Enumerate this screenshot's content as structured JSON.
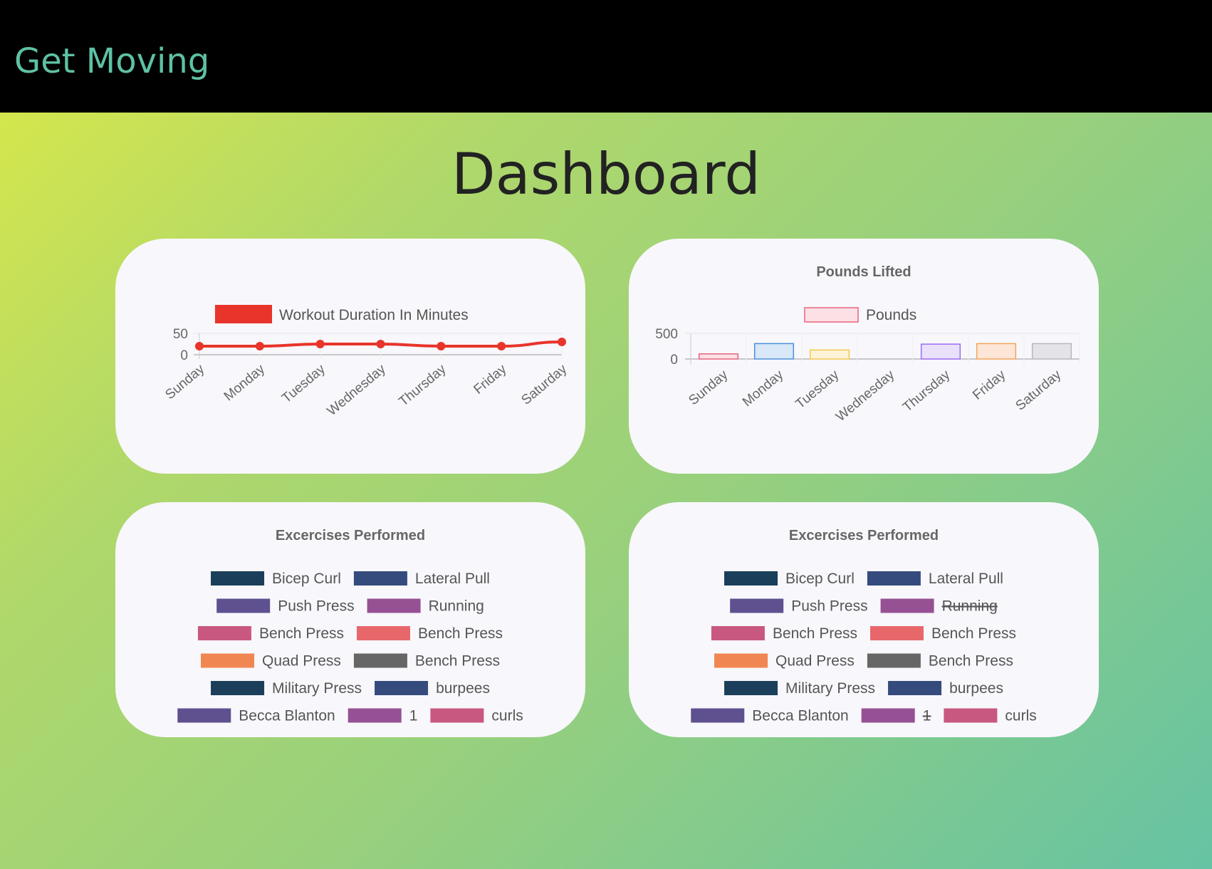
{
  "navbar": {
    "brand": "Get Moving"
  },
  "page": {
    "title": "Dashboard"
  },
  "colors": {
    "brand": "#5ec1a4",
    "line": "#e8342a",
    "palette": [
      "#1b3e5a",
      "#354b7d",
      "#5f5190",
      "#955193",
      "#c8587f",
      "#e8676b",
      "#f08652",
      "#666666"
    ]
  },
  "chart_data": [
    {
      "type": "line",
      "title": "",
      "legend": "Workout Duration In Minutes",
      "legend_position": "top",
      "x": [
        "Sunday",
        "Monday",
        "Tuesday",
        "Wednesday",
        "Thursday",
        "Friday",
        "Saturday"
      ],
      "series": [
        {
          "name": "Workout Duration In Minutes",
          "values": [
            20,
            20,
            25,
            25,
            20,
            20,
            30
          ],
          "color": "#e8342a"
        }
      ],
      "y_ticks": [
        "50",
        "0"
      ],
      "ylim": [
        0,
        50
      ],
      "grid": true
    },
    {
      "type": "bar",
      "title": "Pounds Lifted",
      "legend": "Pounds",
      "legend_position": "top",
      "categories": [
        "Sunday",
        "Monday",
        "Tuesday",
        "Wednesday",
        "Thursday",
        "Friday",
        "Saturday"
      ],
      "series": [
        {
          "name": "Pounds",
          "values": [
            100,
            300,
            175,
            0,
            290,
            300,
            300
          ]
        }
      ],
      "bar_fills": [
        "#fbe0e6",
        "#d8e8f8",
        "#fdf3d8",
        "#e4ecf5",
        "#e9e0fb",
        "#fde6d8",
        "#e4e4e8"
      ],
      "bar_strokes": [
        "#e8647f",
        "#4a90d9",
        "#f2c94c",
        "#9ab",
        "#9b6cf0",
        "#f2a65a",
        "#b8b8bd"
      ],
      "y_ticks": [
        "500",
        "0"
      ],
      "ylim": [
        0,
        500
      ],
      "grid": true
    },
    {
      "type": "pie",
      "title": "Excercises Performed",
      "legend_position": "top",
      "legend_rows": [
        [
          "Bicep Curl",
          "Lateral Pull"
        ],
        [
          "Push Press",
          "Running"
        ],
        [
          "Bench Press",
          "Bench Press"
        ],
        [
          "Quad Press",
          "Bench Press"
        ],
        [
          "Military Press",
          "burpees"
        ],
        [
          "Becca Blanton",
          "1",
          "curls"
        ]
      ],
      "legend_colors": [
        [
          "#1b3e5a",
          "#354b7d"
        ],
        [
          "#5f5190",
          "#955193"
        ],
        [
          "#c8587f",
          "#e8676b"
        ],
        [
          "#f08652",
          "#666666"
        ],
        [
          "#1b3e5a",
          "#354b7d"
        ],
        [
          "#5f5190",
          "#955193",
          "#c8587f"
        ]
      ],
      "hidden": []
    },
    {
      "type": "pie",
      "title": "Excercises Performed",
      "legend_position": "top",
      "legend_rows": [
        [
          "Bicep Curl",
          "Lateral Pull"
        ],
        [
          "Push Press",
          "Running"
        ],
        [
          "Bench Press",
          "Bench Press"
        ],
        [
          "Quad Press",
          "Bench Press"
        ],
        [
          "Military Press",
          "burpees"
        ],
        [
          "Becca Blanton",
          "1",
          "curls"
        ]
      ],
      "legend_colors": [
        [
          "#1b3e5a",
          "#354b7d"
        ],
        [
          "#5f5190",
          "#955193"
        ],
        [
          "#c8587f",
          "#e8676b"
        ],
        [
          "#f08652",
          "#666666"
        ],
        [
          "#1b3e5a",
          "#354b7d"
        ],
        [
          "#5f5190",
          "#955193",
          "#c8587f"
        ]
      ],
      "hidden": [
        "Running",
        "1"
      ]
    }
  ]
}
